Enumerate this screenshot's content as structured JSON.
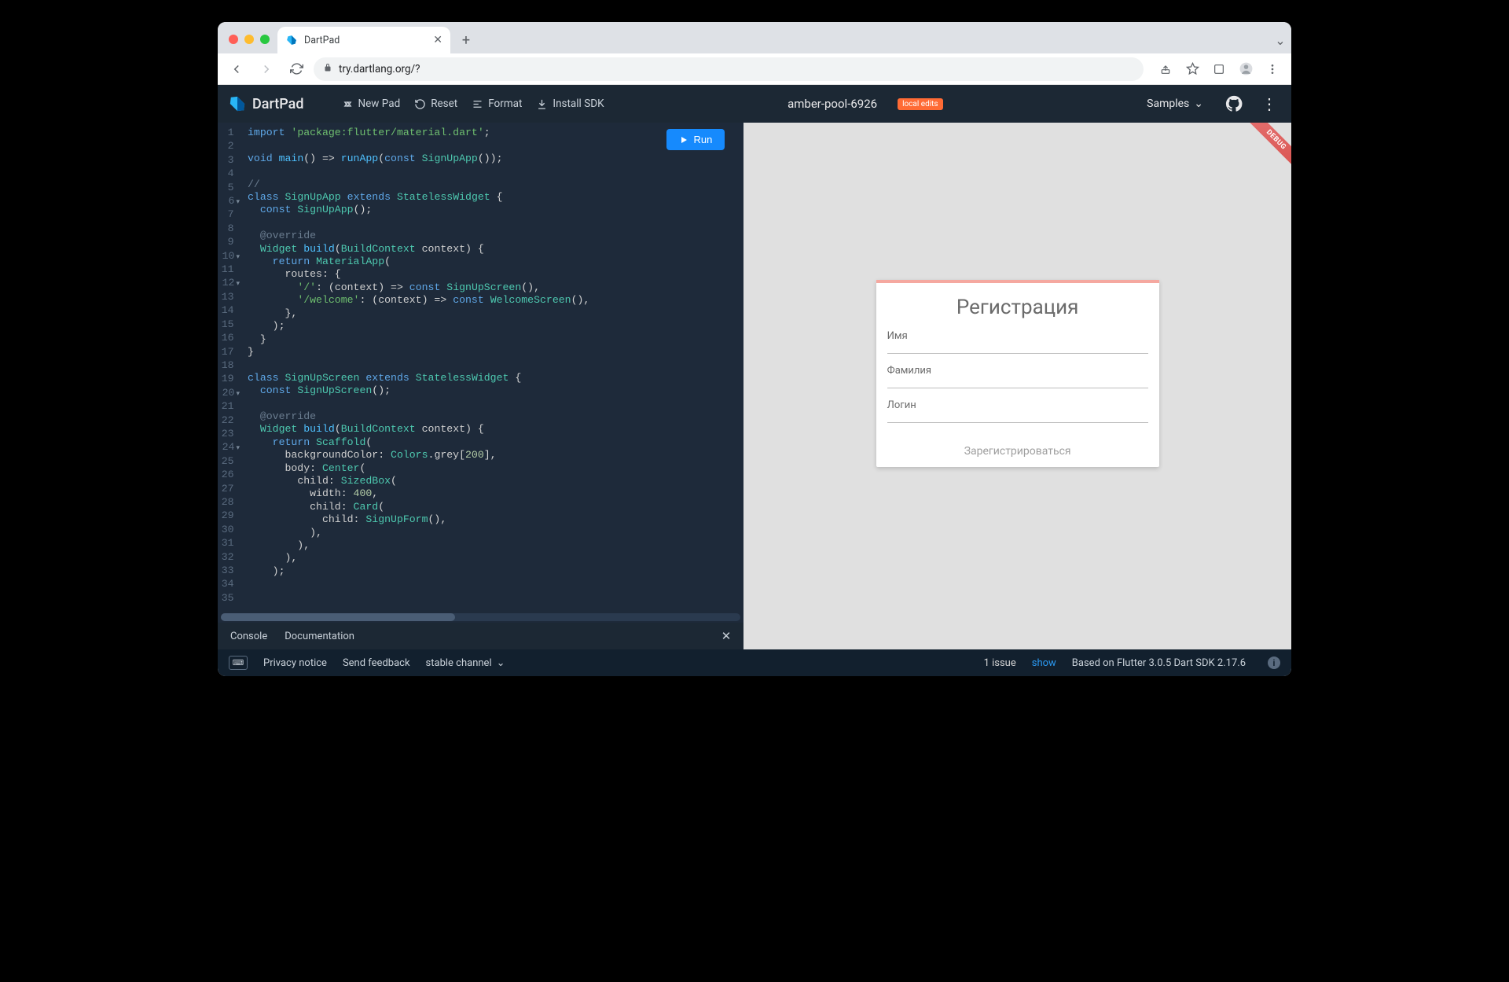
{
  "browser": {
    "tab_title": "DartPad",
    "url": "try.dartlang.org/?"
  },
  "header": {
    "logo_text": "DartPad",
    "new_pad": "New Pad",
    "reset": "Reset",
    "format": "Format",
    "install_sdk": "Install SDK",
    "project_name": "amber-pool-6926",
    "badge": "local edits",
    "samples": "Samples"
  },
  "editor": {
    "run_label": "Run",
    "lines": [
      {
        "n": "1",
        "fold": ""
      },
      {
        "n": "2",
        "fold": ""
      },
      {
        "n": "3",
        "fold": ""
      },
      {
        "n": "4",
        "fold": ""
      },
      {
        "n": "5",
        "fold": ""
      },
      {
        "n": "6",
        "fold": "▾"
      },
      {
        "n": "7",
        "fold": ""
      },
      {
        "n": "8",
        "fold": ""
      },
      {
        "n": "9",
        "fold": ""
      },
      {
        "n": "10",
        "fold": "▾"
      },
      {
        "n": "11",
        "fold": ""
      },
      {
        "n": "12",
        "fold": "▾"
      },
      {
        "n": "13",
        "fold": ""
      },
      {
        "n": "14",
        "fold": ""
      },
      {
        "n": "15",
        "fold": ""
      },
      {
        "n": "16",
        "fold": ""
      },
      {
        "n": "17",
        "fold": ""
      },
      {
        "n": "18",
        "fold": ""
      },
      {
        "n": "19",
        "fold": ""
      },
      {
        "n": "20",
        "fold": "▾"
      },
      {
        "n": "21",
        "fold": ""
      },
      {
        "n": "22",
        "fold": ""
      },
      {
        "n": "23",
        "fold": ""
      },
      {
        "n": "24",
        "fold": "▾"
      },
      {
        "n": "25",
        "fold": ""
      },
      {
        "n": "26",
        "fold": ""
      },
      {
        "n": "27",
        "fold": ""
      },
      {
        "n": "28",
        "fold": ""
      },
      {
        "n": "29",
        "fold": ""
      },
      {
        "n": "30",
        "fold": ""
      },
      {
        "n": "31",
        "fold": ""
      },
      {
        "n": "32",
        "fold": ""
      },
      {
        "n": "33",
        "fold": ""
      },
      {
        "n": "34",
        "fold": ""
      },
      {
        "n": "35",
        "fold": ""
      }
    ],
    "code_tokens": [
      [
        [
          "kw",
          "import"
        ],
        [
          "op",
          " "
        ],
        [
          "str",
          "'package:flutter/material.dart'"
        ],
        [
          "op",
          ";"
        ]
      ],
      [],
      [
        [
          "kw",
          "void"
        ],
        [
          "op",
          " "
        ],
        [
          "fn",
          "main"
        ],
        [
          "op",
          "() => "
        ],
        [
          "fn",
          "runApp"
        ],
        [
          "op",
          "("
        ],
        [
          "kw",
          "const"
        ],
        [
          "op",
          " "
        ],
        [
          "type",
          "SignUpApp"
        ],
        [
          "op",
          "());"
        ]
      ],
      [],
      [
        [
          "cm",
          "//"
        ]
      ],
      [
        [
          "kw",
          "class"
        ],
        [
          "op",
          " "
        ],
        [
          "type",
          "SignUpApp"
        ],
        [
          "op",
          " "
        ],
        [
          "kw",
          "extends"
        ],
        [
          "op",
          " "
        ],
        [
          "type",
          "StatelessWidget"
        ],
        [
          "op",
          " {"
        ]
      ],
      [
        [
          "op",
          "  "
        ],
        [
          "kw",
          "const"
        ],
        [
          "op",
          " "
        ],
        [
          "type",
          "SignUpApp"
        ],
        [
          "op",
          "();"
        ]
      ],
      [],
      [
        [
          "op",
          "  "
        ],
        [
          "cm",
          "@override"
        ]
      ],
      [
        [
          "op",
          "  "
        ],
        [
          "type",
          "Widget"
        ],
        [
          "op",
          " "
        ],
        [
          "fn",
          "build"
        ],
        [
          "op",
          "("
        ],
        [
          "type",
          "BuildContext"
        ],
        [
          "op",
          " "
        ],
        [
          "id",
          "context"
        ],
        [
          "op",
          ") {"
        ]
      ],
      [
        [
          "op",
          "    "
        ],
        [
          "kw",
          "return"
        ],
        [
          "op",
          " "
        ],
        [
          "type",
          "MaterialApp"
        ],
        [
          "op",
          "("
        ]
      ],
      [
        [
          "op",
          "      "
        ],
        [
          "id",
          "routes"
        ],
        [
          "op",
          ": {"
        ]
      ],
      [
        [
          "op",
          "        "
        ],
        [
          "str",
          "'/'"
        ],
        [
          "op",
          ": ("
        ],
        [
          "id",
          "context"
        ],
        [
          "op",
          ") => "
        ],
        [
          "kw",
          "const"
        ],
        [
          "op",
          " "
        ],
        [
          "type",
          "SignUpScreen"
        ],
        [
          "op",
          "(),"
        ]
      ],
      [
        [
          "op",
          "        "
        ],
        [
          "str",
          "'/welcome'"
        ],
        [
          "op",
          ": ("
        ],
        [
          "id",
          "context"
        ],
        [
          "op",
          ") => "
        ],
        [
          "kw",
          "const"
        ],
        [
          "op",
          " "
        ],
        [
          "type",
          "WelcomeScreen"
        ],
        [
          "op",
          "(),"
        ]
      ],
      [
        [
          "op",
          "      },"
        ]
      ],
      [
        [
          "op",
          "    );"
        ]
      ],
      [
        [
          "op",
          "  }"
        ]
      ],
      [
        [
          "op",
          "}"
        ]
      ],
      [],
      [
        [
          "kw",
          "class"
        ],
        [
          "op",
          " "
        ],
        [
          "type",
          "SignUpScreen"
        ],
        [
          "op",
          " "
        ],
        [
          "kw",
          "extends"
        ],
        [
          "op",
          " "
        ],
        [
          "type",
          "StatelessWidget"
        ],
        [
          "op",
          " {"
        ]
      ],
      [
        [
          "op",
          "  "
        ],
        [
          "kw",
          "const"
        ],
        [
          "op",
          " "
        ],
        [
          "type",
          "SignUpScreen"
        ],
        [
          "op",
          "();"
        ]
      ],
      [],
      [
        [
          "op",
          "  "
        ],
        [
          "cm",
          "@override"
        ]
      ],
      [
        [
          "op",
          "  "
        ],
        [
          "type",
          "Widget"
        ],
        [
          "op",
          " "
        ],
        [
          "fn",
          "build"
        ],
        [
          "op",
          "("
        ],
        [
          "type",
          "BuildContext"
        ],
        [
          "op",
          " "
        ],
        [
          "id",
          "context"
        ],
        [
          "op",
          ") {"
        ]
      ],
      [
        [
          "op",
          "    "
        ],
        [
          "kw",
          "return"
        ],
        [
          "op",
          " "
        ],
        [
          "type",
          "Scaffold"
        ],
        [
          "op",
          "("
        ]
      ],
      [
        [
          "op",
          "      "
        ],
        [
          "id",
          "backgroundColor"
        ],
        [
          "op",
          ": "
        ],
        [
          "type",
          "Colors"
        ],
        [
          "op",
          "."
        ],
        [
          "id",
          "grey"
        ],
        [
          "op",
          "["
        ],
        [
          "num",
          "200"
        ],
        [
          "op",
          "],"
        ]
      ],
      [
        [
          "op",
          "      "
        ],
        [
          "id",
          "body"
        ],
        [
          "op",
          ": "
        ],
        [
          "type",
          "Center"
        ],
        [
          "op",
          "("
        ]
      ],
      [
        [
          "op",
          "        "
        ],
        [
          "id",
          "child"
        ],
        [
          "op",
          ": "
        ],
        [
          "type",
          "SizedBox"
        ],
        [
          "op",
          "("
        ]
      ],
      [
        [
          "op",
          "          "
        ],
        [
          "id",
          "width"
        ],
        [
          "op",
          ": "
        ],
        [
          "num",
          "400"
        ],
        [
          "op",
          ","
        ]
      ],
      [
        [
          "op",
          "          "
        ],
        [
          "id",
          "child"
        ],
        [
          "op",
          ": "
        ],
        [
          "type",
          "Card"
        ],
        [
          "op",
          "("
        ]
      ],
      [
        [
          "op",
          "            "
        ],
        [
          "id",
          "child"
        ],
        [
          "op",
          ": "
        ],
        [
          "type",
          "SignUpForm"
        ],
        [
          "op",
          "(),"
        ]
      ],
      [
        [
          "op",
          "          ),"
        ]
      ],
      [
        [
          "op",
          "        ),"
        ]
      ],
      [
        [
          "op",
          "      ),"
        ]
      ],
      [
        [
          "op",
          "    );"
        ]
      ]
    ]
  },
  "preview": {
    "debug_label": "DEBUG",
    "title": "Регистрация",
    "field_name": "Имя",
    "field_surname": "Фамилия",
    "field_login": "Логин",
    "submit": "Зарегистрироваться"
  },
  "console": {
    "tab_console": "Console",
    "tab_docs": "Documentation"
  },
  "footer": {
    "privacy": "Privacy notice",
    "feedback": "Send feedback",
    "channel": "stable channel",
    "issue_count": "1 issue",
    "show": "show",
    "sdk": "Based on Flutter 3.0.5 Dart SDK 2.17.6"
  }
}
